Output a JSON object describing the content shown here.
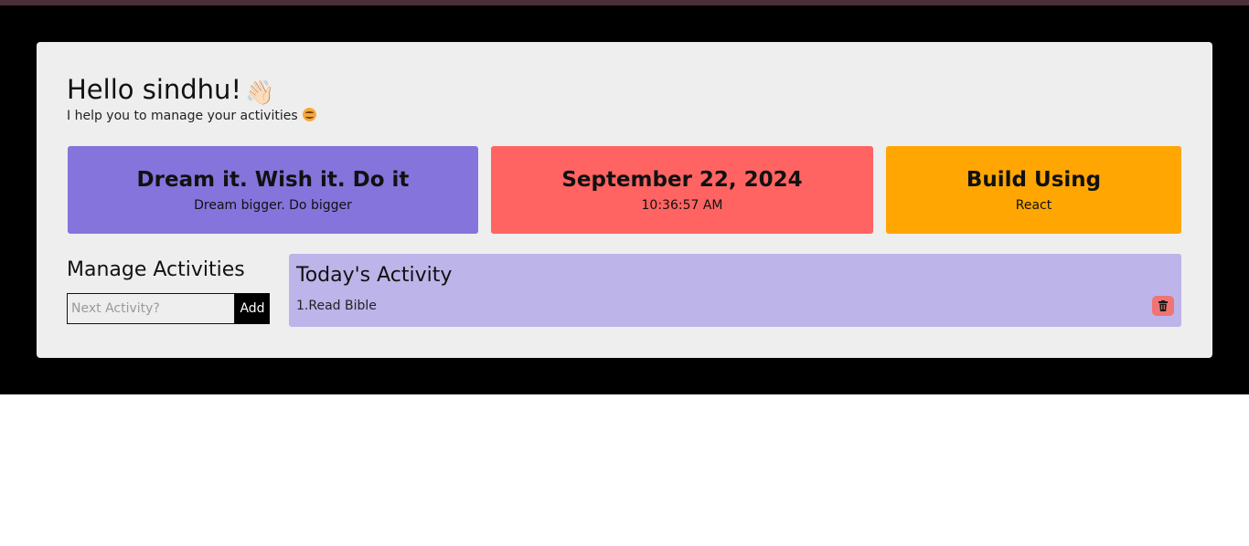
{
  "greeting": {
    "title": "Hello sindhu!",
    "wave_icon": "👋🏻",
    "subtitle": "I help you to manage your activities",
    "smile_icon": "smiling-face-icon"
  },
  "cards": {
    "dream": {
      "title": "Dream it. Wish it. Do it",
      "subtitle": "Dream bigger. Do bigger",
      "color": "#8574db"
    },
    "date": {
      "title": "September 22, 2024",
      "subtitle": "10:36:57 AM",
      "color": "#ff6462"
    },
    "build": {
      "title": "Build Using",
      "subtitle": "React",
      "color": "#ffa602"
    }
  },
  "manage": {
    "title": "Manage Activities",
    "input_placeholder": "Next Activity?",
    "input_value": "",
    "add_label": "Add"
  },
  "today": {
    "title": "Today's Activity",
    "items": [
      {
        "label": "1.Read Bible",
        "delete_icon": "trash-icon"
      }
    ],
    "color": "#bdb4e9"
  },
  "colors": {
    "page_background": "#000000",
    "panel_background": "#eeeeee",
    "delete_button": "#f07474"
  }
}
